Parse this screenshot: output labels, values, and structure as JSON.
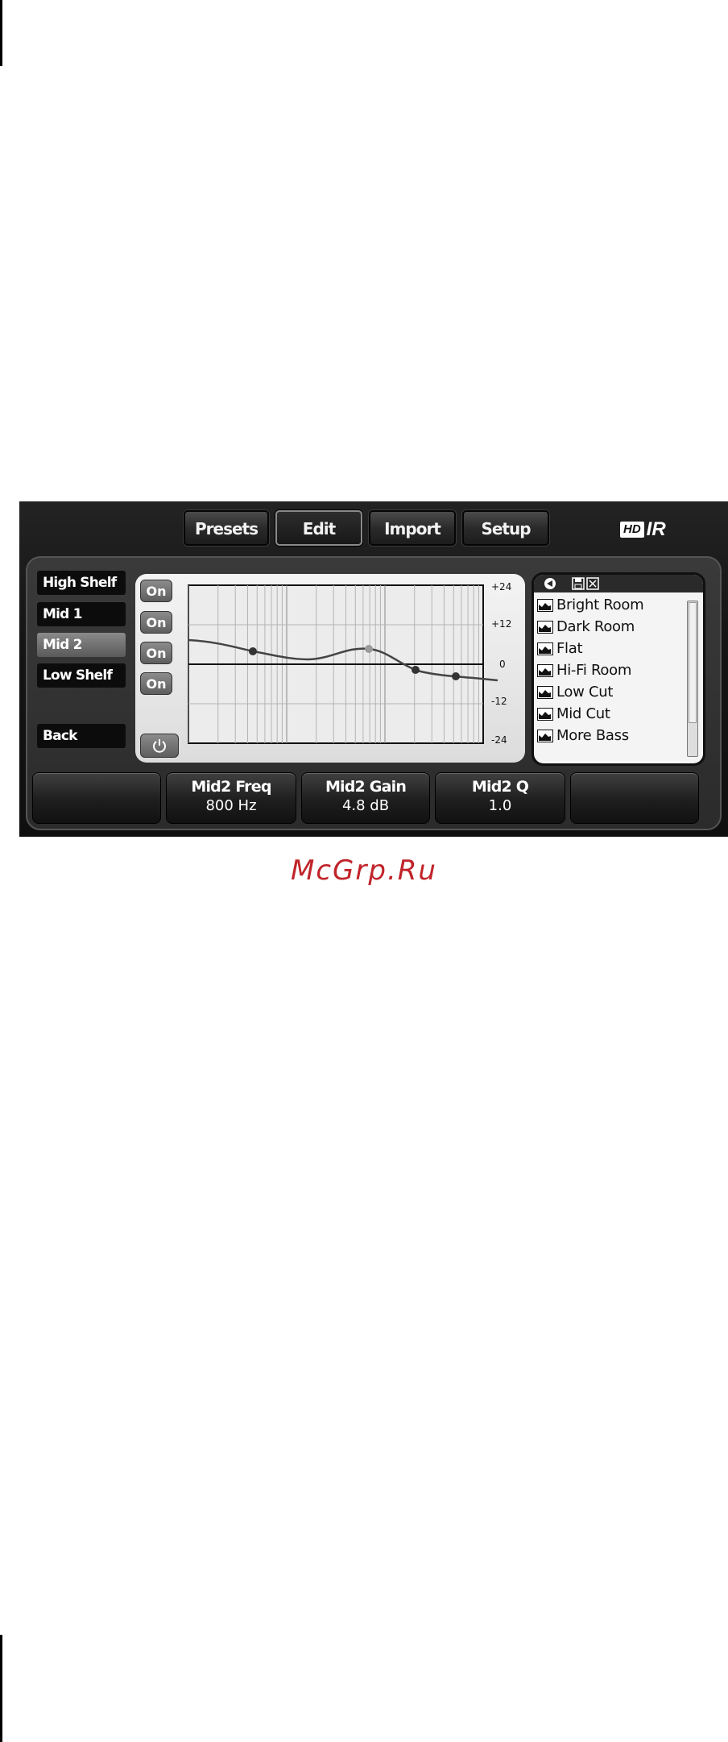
{
  "toolbar": {
    "presets_label": "Presets",
    "edit_label": "Edit",
    "import_label": "Import",
    "setup_label": "Setup"
  },
  "logo": {
    "hd": "HD",
    "ir": "IR"
  },
  "bands": [
    {
      "label": "High Shelf",
      "on_label": "On"
    },
    {
      "label": "Mid 1",
      "on_label": "On"
    },
    {
      "label": "Mid 2",
      "on_label": "On",
      "selected": true
    },
    {
      "label": "Low Shelf",
      "on_label": "On"
    }
  ],
  "back_label": "Back",
  "graph": {
    "y_ticks": [
      "+24",
      "+12",
      "0",
      "-12",
      "-24"
    ],
    "y_range": [
      -24,
      24
    ],
    "curve_color": "#444444",
    "selected_point_color": "#9a9a9a"
  },
  "presets": {
    "items": [
      "Bright Room",
      "Dark Room",
      "Flat",
      "Hi-Fi Room",
      "Low Cut",
      "Mid Cut",
      "More Bass"
    ]
  },
  "knobs": [
    {
      "name": "",
      "value": ""
    },
    {
      "name": "Mid2 Freq",
      "value": "800 Hz"
    },
    {
      "name": "Mid2 Gain",
      "value": "4.8 dB"
    },
    {
      "name": "Mid2 Q",
      "value": "1.0"
    },
    {
      "name": "",
      "value": ""
    }
  ],
  "watermark": "McGrp.Ru"
}
